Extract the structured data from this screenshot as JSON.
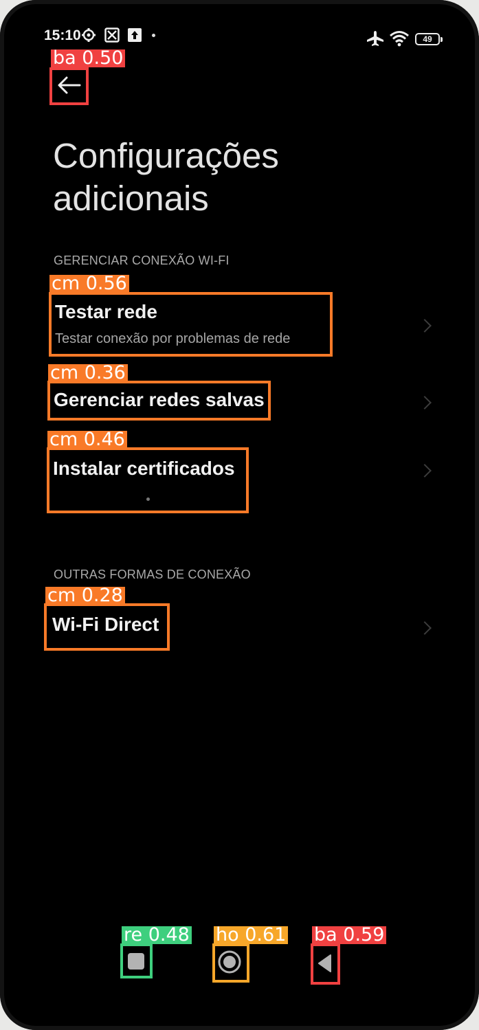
{
  "status_bar": {
    "time": "15:10",
    "battery": "49",
    "icons": [
      "gear-icon",
      "scan-icon",
      "upload-icon",
      "airplane-icon",
      "wifi-icon",
      "battery-icon"
    ]
  },
  "page": {
    "title_line1": "Configurações",
    "title_line2": "adicionais"
  },
  "sections": {
    "manage_wifi": "GERENCIAR CONEXÃO WI-FI",
    "other_connections": "OUTRAS FORMAS DE CONEXÃO"
  },
  "items": {
    "test_network_title": "Testar rede",
    "test_network_subtitle": "Testar conexão por problemas de rede",
    "saved_networks": "Gerenciar redes salvas",
    "install_certificates": "Instalar certificados",
    "wifi_direct": "Wi-Fi Direct"
  },
  "detections": {
    "back_top": "ba 0.50",
    "test_network": "cm 0.56",
    "saved_networks": "cm 0.36",
    "install_certificates": "cm 0.46",
    "wifi_direct": "cm 0.28",
    "recents": "re 0.48",
    "home": "ho 0.61",
    "back_nav": "ba 0.59"
  },
  "colors": {
    "background": "#000000",
    "detection_red": "#f04141",
    "detection_orange": "#f97a28",
    "detection_green": "#3ecf7e",
    "detection_yellow": "#f7a72a"
  }
}
